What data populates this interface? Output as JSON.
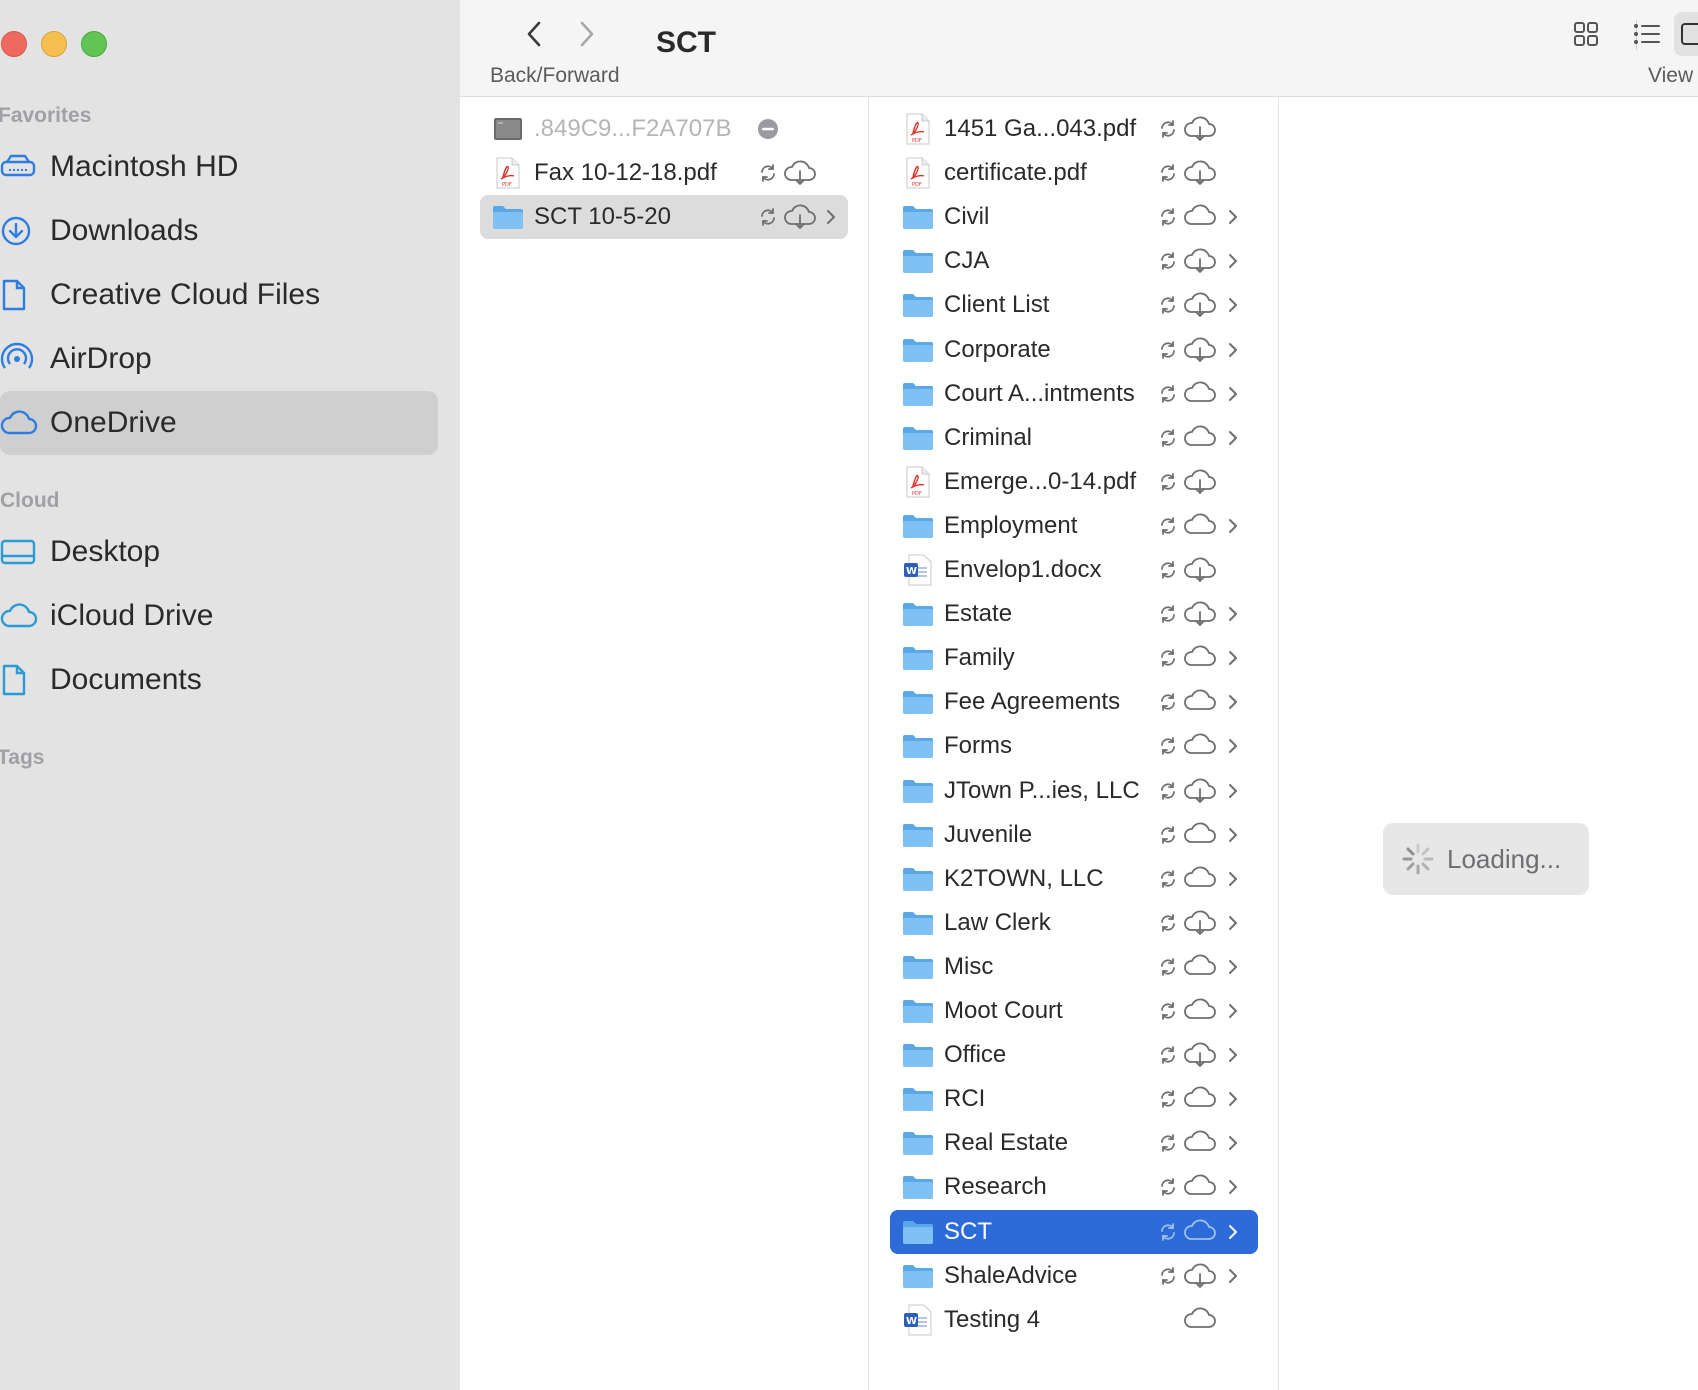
{
  "window": {
    "title": "SCT",
    "nav_label": "Back/Forward",
    "view_label": "View"
  },
  "sidebar": {
    "sections": [
      {
        "label": "Favorites"
      },
      {
        "label": "Cloud"
      },
      {
        "label": "Tags"
      }
    ],
    "favorites": [
      {
        "label": "Macintosh HD",
        "icon": "drive-icon"
      },
      {
        "label": "Downloads",
        "icon": "download-icon"
      },
      {
        "label": "Creative Cloud Files",
        "icon": "document-icon"
      },
      {
        "label": "AirDrop",
        "icon": "airdrop-icon"
      },
      {
        "label": "OneDrive",
        "icon": "cloud-icon",
        "selected": true
      }
    ],
    "cloud": [
      {
        "label": "Desktop",
        "icon": "desktop-icon"
      },
      {
        "label": "iCloud Drive",
        "icon": "cloud-icon"
      },
      {
        "label": "Documents",
        "icon": "document-icon"
      }
    ]
  },
  "column1": [
    {
      "name": ".849C9...F2A707B",
      "type": "file-dim",
      "status": "excluded"
    },
    {
      "name": "Fax 10-12-18.pdf",
      "type": "pdf",
      "status": "download"
    },
    {
      "name": "SCT 10-5-20",
      "type": "folder",
      "status": "download",
      "selected": true
    }
  ],
  "column2": [
    {
      "name": "1451 Ga...043.pdf",
      "type": "pdf",
      "cloud": "download"
    },
    {
      "name": "certificate.pdf",
      "type": "pdf",
      "cloud": "download"
    },
    {
      "name": "Civil",
      "type": "folder",
      "cloud": "cloud"
    },
    {
      "name": "CJA",
      "type": "folder",
      "cloud": "download"
    },
    {
      "name": "Client List",
      "type": "folder",
      "cloud": "download"
    },
    {
      "name": "Corporate",
      "type": "folder",
      "cloud": "download"
    },
    {
      "name": "Court A...intments",
      "type": "folder",
      "cloud": "cloud"
    },
    {
      "name": "Criminal",
      "type": "folder",
      "cloud": "cloud"
    },
    {
      "name": "Emerge...0-14.pdf",
      "type": "pdf",
      "cloud": "download"
    },
    {
      "name": "Employment",
      "type": "folder",
      "cloud": "cloud"
    },
    {
      "name": "Envelop1.docx",
      "type": "docx",
      "cloud": "download"
    },
    {
      "name": "Estate",
      "type": "folder",
      "cloud": "download"
    },
    {
      "name": "Family",
      "type": "folder",
      "cloud": "cloud"
    },
    {
      "name": "Fee Agreements",
      "type": "folder",
      "cloud": "cloud"
    },
    {
      "name": "Forms",
      "type": "folder",
      "cloud": "cloud"
    },
    {
      "name": "JTown P...ies, LLC",
      "type": "folder",
      "cloud": "download"
    },
    {
      "name": "Juvenile",
      "type": "folder",
      "cloud": "cloud"
    },
    {
      "name": "K2TOWN, LLC",
      "type": "folder",
      "cloud": "cloud"
    },
    {
      "name": "Law Clerk",
      "type": "folder",
      "cloud": "download"
    },
    {
      "name": "Misc",
      "type": "folder",
      "cloud": "cloud"
    },
    {
      "name": "Moot Court",
      "type": "folder",
      "cloud": "cloud"
    },
    {
      "name": "Office",
      "type": "folder",
      "cloud": "download"
    },
    {
      "name": "RCI",
      "type": "folder",
      "cloud": "cloud"
    },
    {
      "name": "Real Estate",
      "type": "folder",
      "cloud": "cloud"
    },
    {
      "name": "Research",
      "type": "folder",
      "cloud": "cloud"
    },
    {
      "name": "SCT",
      "type": "folder",
      "cloud": "cloud",
      "selected": true
    },
    {
      "name": "ShaleAdvice",
      "type": "folder",
      "cloud": "download"
    },
    {
      "name": "Testing 4",
      "type": "docx",
      "cloud": "cloud-only"
    }
  ],
  "preview": {
    "loading_text": "Loading..."
  },
  "colors": {
    "selection_blue": "#2d6bd8",
    "folder_blue": "#6cb4ee",
    "sidebar_icon": "#2f7de1"
  }
}
